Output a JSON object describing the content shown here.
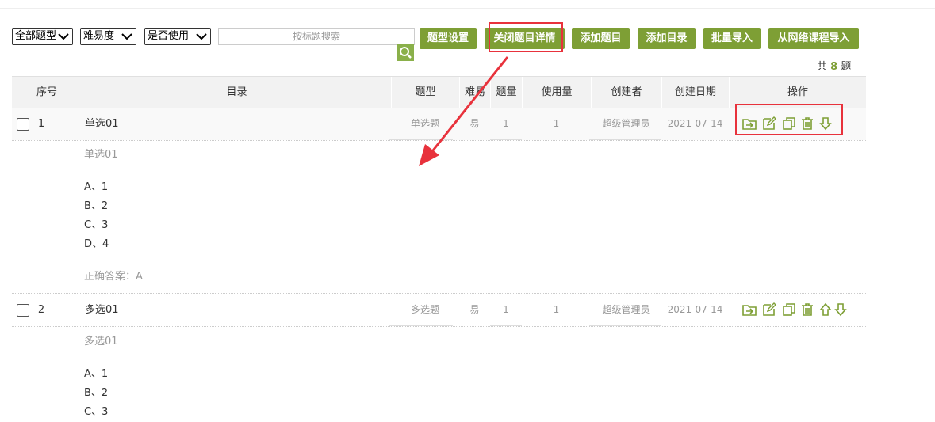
{
  "filters": {
    "type_select": "全部题型",
    "difficulty_select": "难易度",
    "usage_select": "是否使用"
  },
  "search": {
    "placeholder": "按标题搜索"
  },
  "buttons": {
    "type_settings": "题型设置",
    "close_details": "关闭题目详情",
    "add_question": "添加题目",
    "add_catalog": "添加目录",
    "bulk_import": "批量导入",
    "import_online": "从网络课程导入"
  },
  "total": {
    "prefix": "共",
    "count": "8",
    "suffix": "题"
  },
  "table": {
    "headers": [
      "序号",
      "目录",
      "题型",
      "难易",
      "题量",
      "使用量",
      "创建者",
      "创建日期",
      "操作"
    ],
    "rows": [
      {
        "index": "1",
        "title": "单选01",
        "type": "单选题",
        "difficulty": "易",
        "amount": "1",
        "usage": "1",
        "creator": "超级管理员",
        "date": "2021-07-14",
        "detail": {
          "stem": "单选01",
          "options": [
            "A、1",
            "B、2",
            "C、3",
            "D、4"
          ],
          "answer": "正确答案：A"
        }
      },
      {
        "index": "2",
        "title": "多选01",
        "type": "多选题",
        "difficulty": "易",
        "amount": "1",
        "usage": "1",
        "creator": "超级管理员",
        "date": "2021-07-14",
        "detail": {
          "stem": "多选01",
          "options": [
            "A、1",
            "B、2",
            "C、3"
          ]
        }
      }
    ]
  },
  "colors": {
    "accent": "#7e9f35",
    "annotation": "#e8323c"
  },
  "icons": [
    "move-to-folder-icon",
    "edit-icon",
    "copy-icon",
    "delete-icon",
    "move-up-icon",
    "move-down-icon"
  ]
}
